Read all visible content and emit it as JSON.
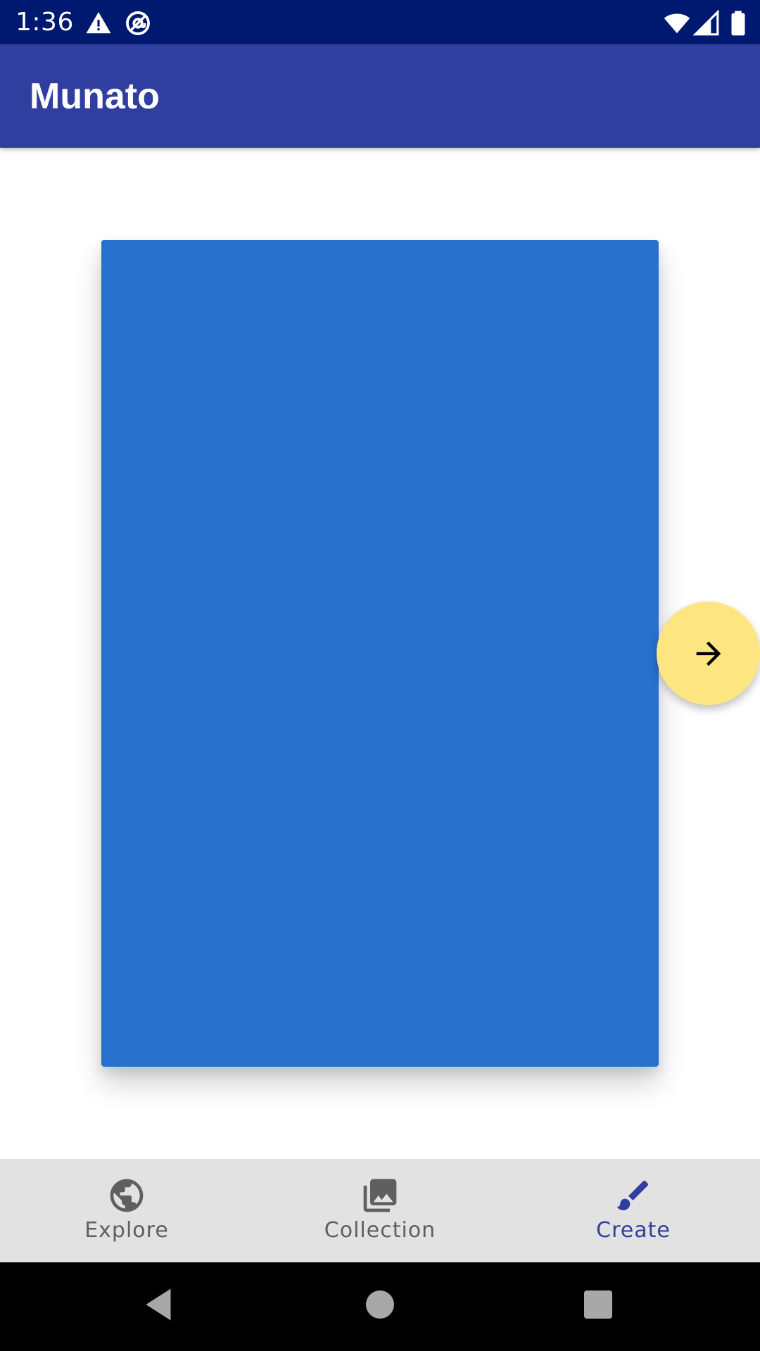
{
  "status_bar": {
    "time": "1:36",
    "icons": [
      "warning-icon",
      "at-sign-icon",
      "wifi-icon",
      "cell-signal-icon",
      "battery-icon"
    ]
  },
  "app_bar": {
    "title": "Munato"
  },
  "canvas": {
    "color": "#2771cd"
  },
  "fab": {
    "icon": "arrow-right-icon",
    "color": "#fde582"
  },
  "bottom_nav": {
    "items": [
      {
        "label": "Explore",
        "icon": "globe-icon",
        "active": false
      },
      {
        "label": "Collection",
        "icon": "photo-library-icon",
        "active": false
      },
      {
        "label": "Create",
        "icon": "brush-icon",
        "active": true
      }
    ]
  },
  "system_nav": {
    "buttons": [
      "back-icon",
      "home-icon",
      "recents-icon"
    ]
  },
  "colors": {
    "status_bar": "#001970",
    "app_bar": "#303f9f",
    "bottom_nav": "#e2e2e2",
    "active": "#303f9f",
    "inactive": "#5f5f5f"
  }
}
